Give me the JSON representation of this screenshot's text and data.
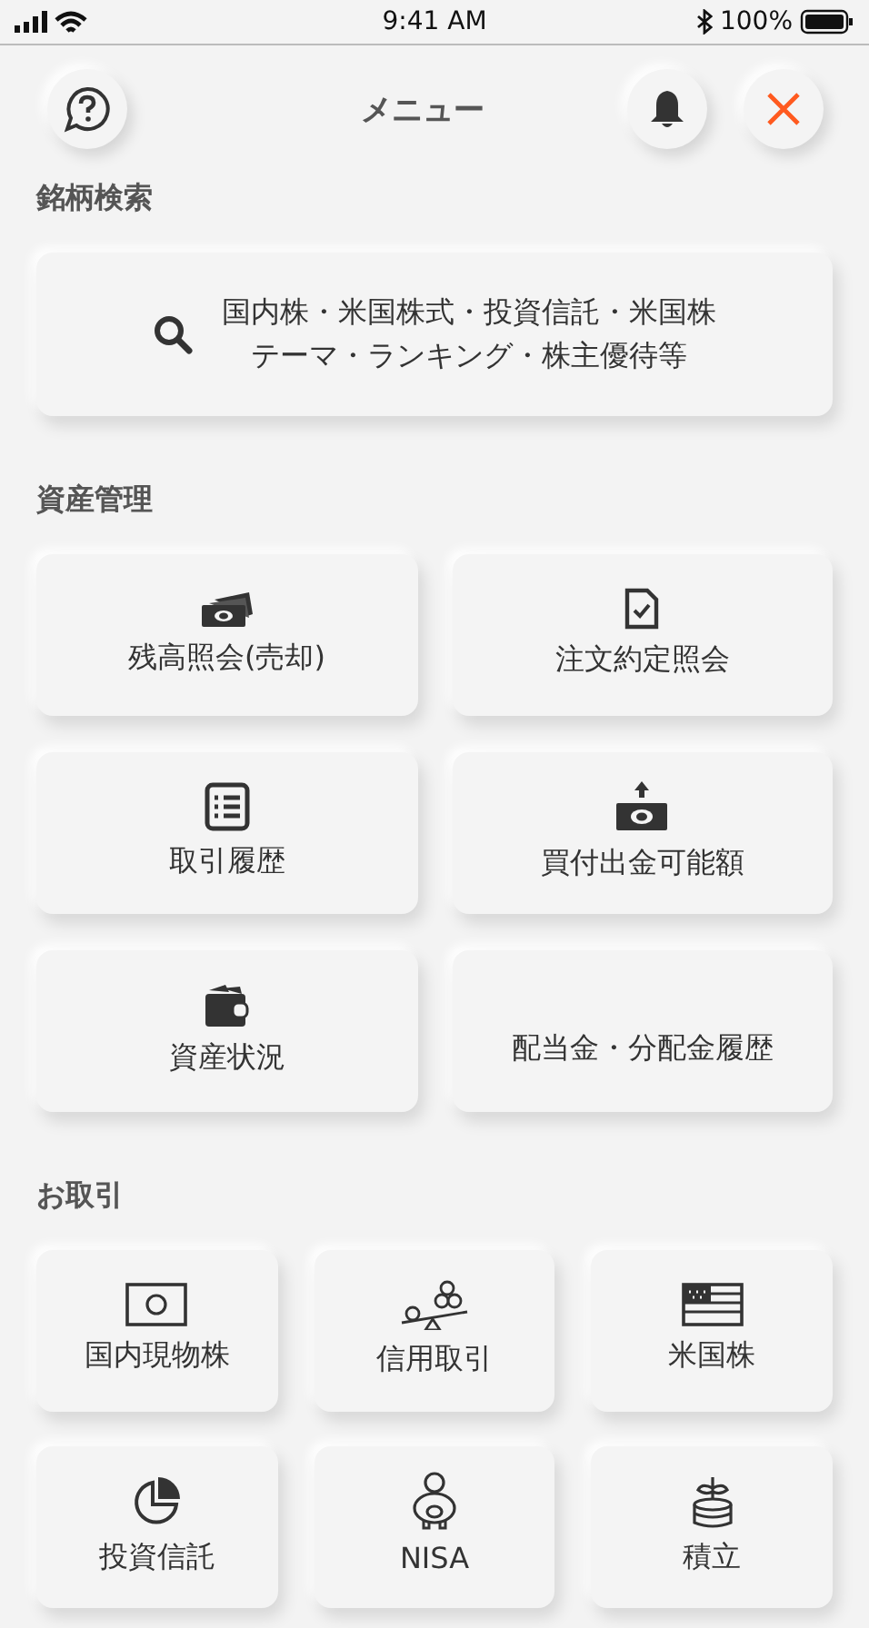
{
  "status_bar": {
    "time": "9:41 AM",
    "battery": "100%"
  },
  "header": {
    "title": "メニュー"
  },
  "sections": [
    {
      "title": "銘柄検索",
      "kind": "search",
      "lines": [
        "国内株・米国株式・投資信託・米国株",
        "テーマ・ランキング・株主優待等"
      ]
    },
    {
      "title": "資産管理",
      "kind": "grid2",
      "items": [
        {
          "label": "残高照会(売却)"
        },
        {
          "label": "注文約定照会"
        },
        {
          "label": "取引履歴"
        },
        {
          "label": "買付出金可能額"
        },
        {
          "label": "資産状況"
        },
        {
          "label": "配当金・分配金履歴"
        }
      ]
    },
    {
      "title": "お取引",
      "kind": "grid3",
      "items": [
        {
          "label": "国内現物株"
        },
        {
          "label": "信用取引"
        },
        {
          "label": "米国株"
        },
        {
          "label": "投資信託"
        },
        {
          "label": "NISA"
        },
        {
          "label": "積立"
        }
      ]
    }
  ]
}
